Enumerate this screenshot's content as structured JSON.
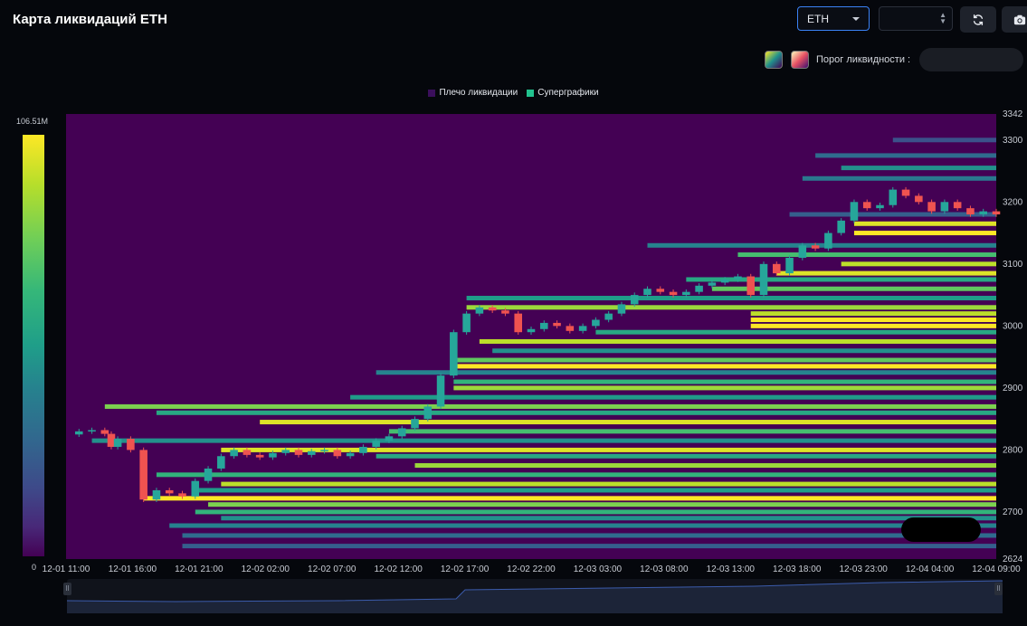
{
  "app": {
    "title": "Карта ликвидаций ETH"
  },
  "toolbar": {
    "symbol_value": "ETH",
    "refresh_icon": "refresh-icon",
    "camera_icon": "camera-icon",
    "threshold_label": "Порог ликвидности :"
  },
  "legend": {
    "items": [
      {
        "label": "Плечо ликвидации",
        "color": "#3b0f5c"
      },
      {
        "label": "Суперграфики",
        "color": "#21c28e"
      }
    ]
  },
  "colorbar": {
    "max_label": "106.51M",
    "min_label": "0"
  },
  "colors": {
    "background": "#440154",
    "up_candle": "#26a69a",
    "down_candle": "#ef5350",
    "accent": "#3b82f6"
  },
  "chart_data": {
    "type": "heatmap",
    "title": "Карта ликвидаций ETH",
    "x_tick_labels": [
      "12-01 11:00",
      "12-01 16:00",
      "12-01 21:00",
      "12-02 02:00",
      "12-02 07:00",
      "12-02 12:00",
      "12-02 17:00",
      "12-02 22:00",
      "12-03 03:00",
      "12-03 08:00",
      "12-03 13:00",
      "12-03 18:00",
      "12-03 23:00",
      "12-04 04:00",
      "12-04 09:00"
    ],
    "x_range_hours": [
      0,
      72
    ],
    "y_tick_labels": [
      "3342",
      "3300",
      "3200",
      "3100",
      "3000",
      "2900",
      "2800",
      "2700",
      "2624"
    ],
    "y_ticks": [
      3342,
      3300,
      3200,
      3100,
      3000,
      2900,
      2800,
      2700,
      2624
    ],
    "ylim": [
      2624,
      3342
    ],
    "colorscale": "viridis",
    "color_range": [
      0,
      106.51
    ],
    "color_unit": "M",
    "price_path": [
      [
        0,
        2825
      ],
      [
        1,
        2830
      ],
      [
        2,
        2832
      ],
      [
        3,
        2826
      ],
      [
        3.5,
        2805
      ],
      [
        4,
        2818
      ],
      [
        5,
        2800
      ],
      [
        6,
        2720
      ],
      [
        7,
        2735
      ],
      [
        8,
        2730
      ],
      [
        9,
        2725
      ],
      [
        10,
        2750
      ],
      [
        11,
        2770
      ],
      [
        12,
        2790
      ],
      [
        13,
        2800
      ],
      [
        14,
        2792
      ],
      [
        15,
        2788
      ],
      [
        16,
        2795
      ],
      [
        17,
        2800
      ],
      [
        18,
        2792
      ],
      [
        19,
        2798
      ],
      [
        20,
        2800
      ],
      [
        21,
        2790
      ],
      [
        22,
        2795
      ],
      [
        23,
        2805
      ],
      [
        24,
        2815
      ],
      [
        25,
        2822
      ],
      [
        26,
        2835
      ],
      [
        27,
        2850
      ],
      [
        28,
        2870
      ],
      [
        29,
        2920
      ],
      [
        30,
        2990
      ],
      [
        31,
        3020
      ],
      [
        32,
        3030
      ],
      [
        33,
        3025
      ],
      [
        34,
        3020
      ],
      [
        35,
        2990
      ],
      [
        36,
        2995
      ],
      [
        37,
        3005
      ],
      [
        38,
        3000
      ],
      [
        39,
        2992
      ],
      [
        40,
        3000
      ],
      [
        41,
        3010
      ],
      [
        42,
        3020
      ],
      [
        43,
        3035
      ],
      [
        44,
        3050
      ],
      [
        45,
        3060
      ],
      [
        46,
        3055
      ],
      [
        47,
        3050
      ],
      [
        48,
        3055
      ],
      [
        49,
        3065
      ],
      [
        50,
        3070
      ],
      [
        51,
        3075
      ],
      [
        52,
        3080
      ],
      [
        53,
        3050
      ],
      [
        54,
        3100
      ],
      [
        55,
        3085
      ],
      [
        56,
        3110
      ],
      [
        57,
        3130
      ],
      [
        58,
        3125
      ],
      [
        59,
        3150
      ],
      [
        60,
        3170
      ],
      [
        61,
        3200
      ],
      [
        62,
        3190
      ],
      [
        63,
        3195
      ],
      [
        64,
        3220
      ],
      [
        65,
        3210
      ],
      [
        66,
        3200
      ],
      [
        67,
        3185
      ],
      [
        68,
        3200
      ],
      [
        69,
        3190
      ],
      [
        70,
        3180
      ],
      [
        71,
        3185
      ],
      [
        72,
        3180
      ]
    ],
    "liquidation_bands": [
      {
        "price": 3300,
        "start": 64,
        "intensity": 0.25
      },
      {
        "price": 3275,
        "start": 58,
        "intensity": 0.35
      },
      {
        "price": 3255,
        "start": 60,
        "intensity": 0.5
      },
      {
        "price": 3238,
        "start": 57,
        "intensity": 0.4
      },
      {
        "price": 3180,
        "start": 56,
        "intensity": 0.3
      },
      {
        "price": 3165,
        "start": 61,
        "intensity": 0.95
      },
      {
        "price": 3150,
        "start": 61,
        "intensity": 1.0
      },
      {
        "price": 3130,
        "start": 45,
        "intensity": 0.45
      },
      {
        "price": 3115,
        "start": 52,
        "intensity": 0.7
      },
      {
        "price": 3100,
        "start": 60,
        "intensity": 0.9
      },
      {
        "price": 3085,
        "start": 55,
        "intensity": 0.95
      },
      {
        "price": 3075,
        "start": 48,
        "intensity": 0.6
      },
      {
        "price": 3060,
        "start": 50,
        "intensity": 0.75
      },
      {
        "price": 3045,
        "start": 31,
        "intensity": 0.55
      },
      {
        "price": 3030,
        "start": 31,
        "intensity": 0.85
      },
      {
        "price": 3020,
        "start": 53,
        "intensity": 0.9
      },
      {
        "price": 3010,
        "start": 53,
        "intensity": 1.0
      },
      {
        "price": 3000,
        "start": 53,
        "intensity": 1.0
      },
      {
        "price": 2990,
        "start": 41,
        "intensity": 0.6
      },
      {
        "price": 2975,
        "start": 32,
        "intensity": 0.9
      },
      {
        "price": 2960,
        "start": 33,
        "intensity": 0.5
      },
      {
        "price": 2945,
        "start": 30,
        "intensity": 0.75
      },
      {
        "price": 2935,
        "start": 30,
        "intensity": 1.0
      },
      {
        "price": 2925,
        "start": 24,
        "intensity": 0.45
      },
      {
        "price": 2910,
        "start": 30,
        "intensity": 0.65
      },
      {
        "price": 2900,
        "start": 30,
        "intensity": 0.85
      },
      {
        "price": 2885,
        "start": 22,
        "intensity": 0.55
      },
      {
        "price": 2870,
        "start": 3,
        "intensity": 0.8
      },
      {
        "price": 2860,
        "start": 7,
        "intensity": 0.6
      },
      {
        "price": 2845,
        "start": 15,
        "intensity": 0.95
      },
      {
        "price": 2830,
        "start": 25,
        "intensity": 0.7
      },
      {
        "price": 2815,
        "start": 2,
        "intensity": 0.5
      },
      {
        "price": 2800,
        "start": 12,
        "intensity": 0.95
      },
      {
        "price": 2790,
        "start": 24,
        "intensity": 0.6
      },
      {
        "price": 2775,
        "start": 27,
        "intensity": 0.85
      },
      {
        "price": 2760,
        "start": 7,
        "intensity": 0.65
      },
      {
        "price": 2745,
        "start": 12,
        "intensity": 0.9
      },
      {
        "price": 2735,
        "start": 10,
        "intensity": 0.55
      },
      {
        "price": 2722,
        "start": 6,
        "intensity": 1.0
      },
      {
        "price": 2712,
        "start": 11,
        "intensity": 0.8
      },
      {
        "price": 2700,
        "start": 10,
        "intensity": 0.65
      },
      {
        "price": 2690,
        "start": 12,
        "intensity": 0.5
      },
      {
        "price": 2678,
        "start": 8,
        "intensity": 0.45
      },
      {
        "price": 2662,
        "start": 9,
        "intensity": 0.35
      },
      {
        "price": 2645,
        "start": 9,
        "intensity": 0.3
      }
    ]
  }
}
